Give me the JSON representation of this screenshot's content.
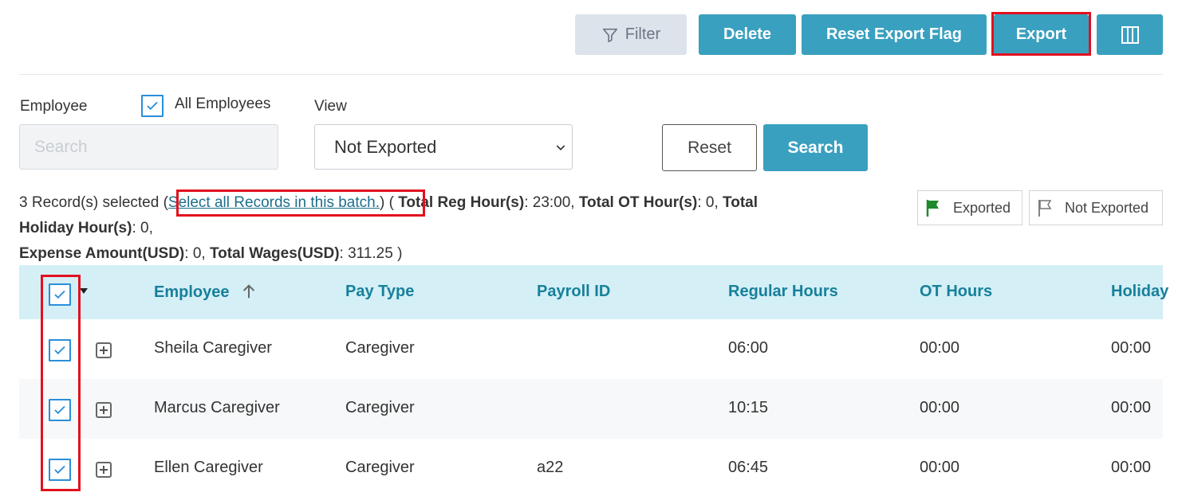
{
  "toolbar": {
    "filter_label": "Filter",
    "delete_label": "Delete",
    "reset_export_flag_label": "Reset Export Flag",
    "export_label": "Export",
    "columns_icon": "columns-icon"
  },
  "form": {
    "employee_label": "Employee",
    "all_employees_label": "All Employees",
    "all_employees_checked": true,
    "search_placeholder": "Search",
    "view_label": "View",
    "view_selected": "Not Exported",
    "reset_label": "Reset",
    "search_button_label": "Search"
  },
  "summary": {
    "selected_text": "3 Record(s) selected",
    "select_all_link": "Select all Records in this batch.",
    "total_reg_hours_label": "Total Reg Hour(s)",
    "total_reg_hours_value": "23:00",
    "total_ot_hours_label": "Total OT Hour(s)",
    "total_ot_hours_value": "0",
    "total_holiday_hours_label_1": "Total",
    "total_holiday_hours_label_2": "Holiday Hour(s)",
    "total_holiday_hours_value": "0,",
    "expense_amount_label": "Expense Amount(USD)",
    "expense_amount_value": "0",
    "total_wages_label": "Total Wages(USD)",
    "total_wages_value": "311.25 )"
  },
  "legend": {
    "exported_label": "Exported",
    "not_exported_label": "Not Exported"
  },
  "table": {
    "columns": [
      "Employee",
      "Pay Type",
      "Payroll ID",
      "Regular Hours",
      "OT Hours",
      "Holiday"
    ],
    "rows": [
      {
        "employee": "Sheila Caregiver",
        "pay_type": "Caregiver",
        "payroll_id": "",
        "regular_hours": "06:00",
        "ot_hours": "00:00",
        "holiday": "00:00",
        "checked": true
      },
      {
        "employee": "Marcus Caregiver",
        "pay_type": "Caregiver",
        "payroll_id": "",
        "regular_hours": "10:15",
        "ot_hours": "00:00",
        "holiday": "00:00",
        "checked": true
      },
      {
        "employee": "Ellen Caregiver",
        "pay_type": "Caregiver",
        "payroll_id": "a22",
        "regular_hours": "06:45",
        "ot_hours": "00:00",
        "holiday": "00:00",
        "checked": true
      }
    ]
  },
  "colors": {
    "accent": "#3aa0bf",
    "header_bg": "#d4eff6",
    "header_text": "#17809a",
    "highlight": "#e3101e",
    "checkbox": "#2a8fd9",
    "flag_green": "#1e8a2e"
  }
}
